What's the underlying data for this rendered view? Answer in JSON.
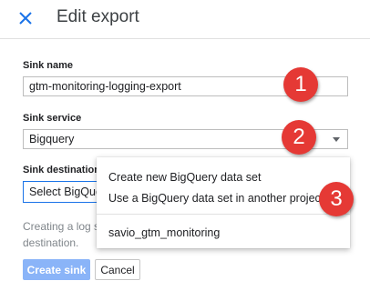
{
  "header": {
    "title": "Edit export",
    "close_icon": "close-icon"
  },
  "form": {
    "sink_name_label": "Sink name",
    "sink_name_value": "gtm-monitoring-logging-export",
    "sink_service_label": "Sink service",
    "sink_service_value": "Bigquery",
    "sink_destination_label": "Sink destination",
    "sink_destination_value": "Select BigQuery data set",
    "helper_line1": "Creating a log sink",
    "helper_line2": "destination."
  },
  "dropdown": {
    "items": [
      "Create new BigQuery data set",
      "Use a BigQuery data set in another project",
      "savio_gtm_monitoring"
    ]
  },
  "buttons": {
    "create": "Create sink",
    "cancel": "Cancel"
  },
  "badges": [
    "1",
    "2",
    "3"
  ],
  "colors": {
    "accent": "#1a73e8",
    "primary_button_disabled": "#8ab4f8",
    "badge": "#e53935"
  }
}
